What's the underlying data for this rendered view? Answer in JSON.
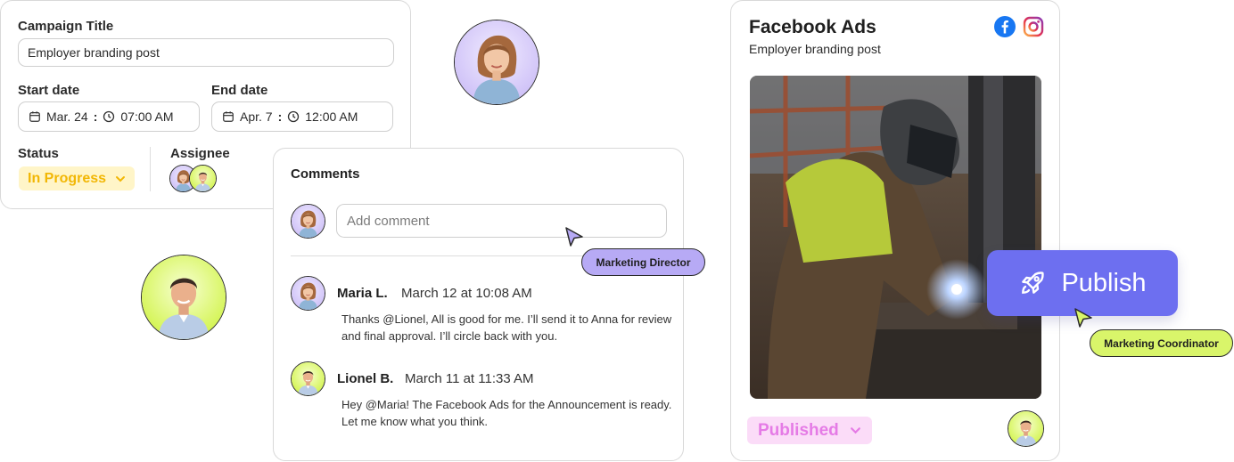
{
  "campaign": {
    "title_label": "Campaign Title",
    "title_value": "Employer branding post",
    "start_label": "Start date",
    "end_label": "End date",
    "start_date": "Mar. 24",
    "start_time": "07:00 AM",
    "end_date": "Apr. 7",
    "end_time": "12:00 AM",
    "status_label": "Status",
    "status_value": "In Progress",
    "assignee_label": "Assignee"
  },
  "comments": {
    "title": "Comments",
    "input_placeholder": "Add comment",
    "items": [
      {
        "author": "Maria L.",
        "date": "March 12 at 10:08 AM",
        "text": "Thanks @Lionel, All is good for me. I’ll send it to Anna for review and final approval. I’ll circle back with you."
      },
      {
        "author": "Lionel B.",
        "date": "March 11 at 11:33 AM",
        "text": "Hey @Maria! The Facebook Ads for the Announcement is ready. Let me know what you think."
      }
    ]
  },
  "tags": {
    "marketing_director": "Marketing Director",
    "marketing_coordinator": "Marketing Coordinator"
  },
  "ad_preview": {
    "title": "Facebook Ads",
    "subtitle": "Employer branding post",
    "status_value": "Published",
    "publish_label": "Publish"
  },
  "icons": [
    "calendar-icon",
    "clock-icon",
    "chevron-down-icon",
    "facebook-icon",
    "instagram-icon",
    "rocket-icon",
    "cursor-icon"
  ],
  "colors": {
    "in_progress_text": "#f2b705",
    "in_progress_bg": "#fff5c8",
    "published_text": "#e57be6",
    "published_bg": "#fbdcf8",
    "publish_button": "#6d6ff0",
    "director_tag": "#b7aaf5",
    "coordinator_tag": "#d9f56a"
  }
}
